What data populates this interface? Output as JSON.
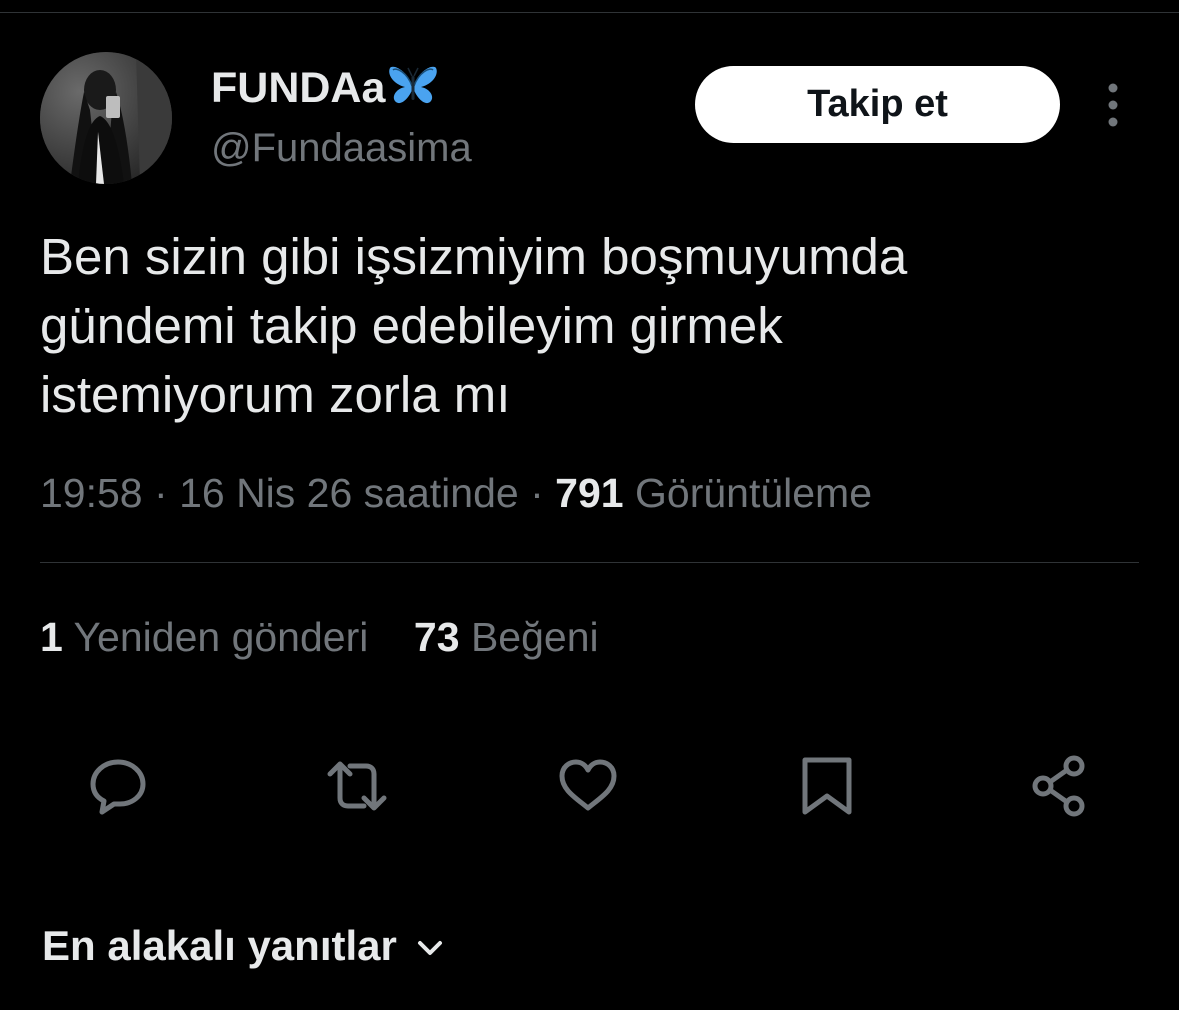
{
  "author": {
    "display_name": "FUNDAa",
    "handle": "@Fundaasima",
    "name_emoji_icon": "butterfly-icon"
  },
  "follow_button_label": "Takip et",
  "tweet": {
    "lines": [
      "Ben sizin gibi işsizmiyim boşmuyumda",
      "gündemi takip edebileyim girmek",
      "istemiyorum zorla mı"
    ]
  },
  "meta": {
    "time": "19:58",
    "separator": "·",
    "date": "16 Nis 26 saatinde",
    "views_count": "791",
    "views_label": "Görüntüleme"
  },
  "stats": {
    "reposts_count": "1",
    "reposts_label": "Yeniden gönderi",
    "likes_count": "73",
    "likes_label": "Beğeni"
  },
  "actions": [
    "reply-icon",
    "repost-icon",
    "like-icon",
    "bookmark-icon",
    "share-icon"
  ],
  "replies_sort_label": "En alakalı yanıtlar",
  "colors": {
    "background": "#000000",
    "primary_text": "#e7e9ea",
    "secondary_text": "#71767b",
    "divider": "#2f3336",
    "follow_button_bg": "#ffffff",
    "butterfly": "#4aa3f0"
  }
}
